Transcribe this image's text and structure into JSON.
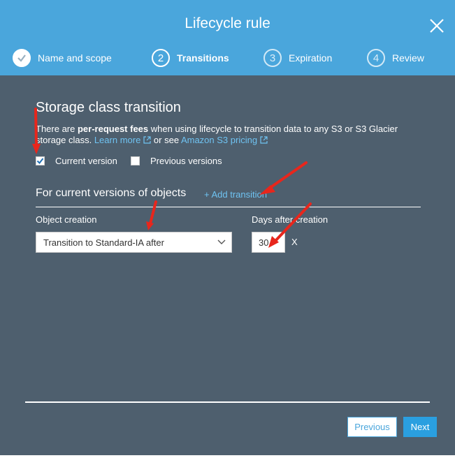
{
  "modal": {
    "title": "Lifecycle rule",
    "close_icon": "close-icon"
  },
  "steps": [
    {
      "number": "1",
      "label": "Name and scope",
      "state": "done"
    },
    {
      "number": "2",
      "label": "Transitions",
      "state": "active"
    },
    {
      "number": "3",
      "label": "Expiration",
      "state": "pending"
    },
    {
      "number": "4",
      "label": "Review",
      "state": "pending"
    }
  ],
  "section": {
    "title": "Storage class transition",
    "desc_before": "There are ",
    "desc_bold": "per-request fees",
    "desc_mid": " when using lifecycle to transition data to any S3 or S3 Glacier storage class. ",
    "learn_more": "Learn more",
    "desc_or": " or see ",
    "pricing_link": "Amazon S3 pricing"
  },
  "versions": {
    "current": {
      "label": "Current version",
      "checked": true
    },
    "previous": {
      "label": "Previous versions",
      "checked": false
    }
  },
  "current_versions": {
    "title": "For current versions of objects",
    "add_transition": "+ Add transition",
    "object_creation_label": "Object creation",
    "transition_select": "Transition to Standard-IA after",
    "days_label": "Days after creation",
    "days_value": "30",
    "remove_label": "X"
  },
  "footer": {
    "previous": "Previous",
    "next": "Next"
  },
  "colors": {
    "header": "#4aa6dc",
    "body": "#4e5f6e",
    "link": "#6fc3f2",
    "primary_button": "#2a9fe0",
    "annotation_arrow": "#e8261c"
  }
}
